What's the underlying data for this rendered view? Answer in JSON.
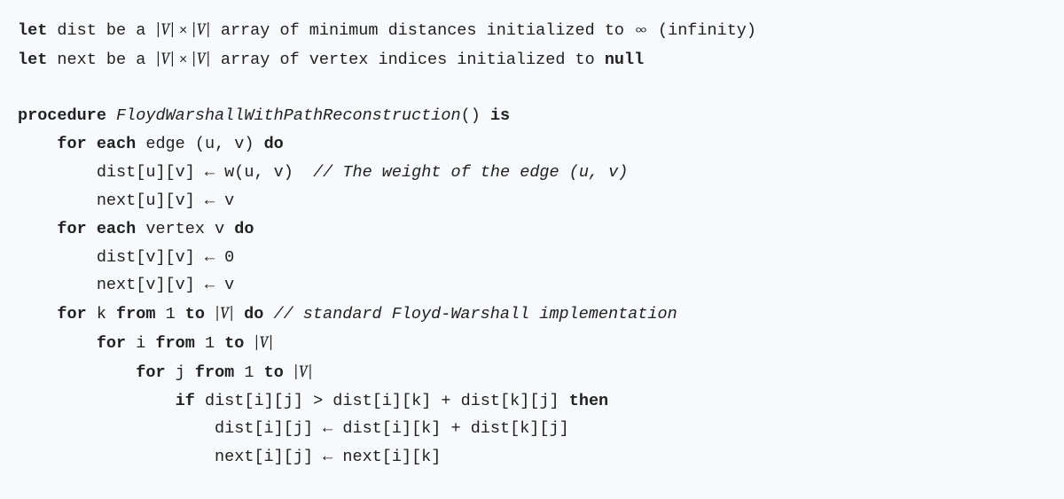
{
  "kw": {
    "let": "let",
    "procedure": "procedure",
    "is": "is",
    "for_each": "for each",
    "for": "for",
    "do": "do",
    "from": "from",
    "to": "to",
    "if": "if",
    "then": "then",
    "null": "null"
  },
  "txt": {
    "dist_decl_a": " dist be a ",
    "dist_decl_b": " array of minimum distances initialized to ",
    "infinity_glyph": "∞",
    "infinity_tail": " (infinity)",
    "next_decl_a": " next be a ",
    "next_decl_b": " array of vertex indices initialized to ",
    "proc_name": "FloydWarshallWithPathReconstruction",
    "parens": "()",
    "edge_uv": " edge (u, v) ",
    "l_dist_uv_assign": "dist[u][v] ← w(u, v)  ",
    "l_next_uv_assign": "next[u][v] ← v",
    "vertex_v": " vertex v ",
    "l_dist_vv_assign": "dist[v][v] ← 0",
    "l_next_vv_assign": "next[v][v] ← v",
    "sp_k": " k ",
    "sp_i": " i ",
    "sp_j": " j ",
    "one_to": " 1 ",
    "sp": " ",
    "if_cond": " dist[i][j] > dist[i][k] + dist[k][j] ",
    "l_dist_ij_assign": "dist[i][j] ← dist[i][k] + dist[k][j]",
    "l_next_ij_assign": "next[i][j] ← next[i][k]"
  },
  "comments": {
    "weight": "// The weight of the edge (u, v)",
    "standard": "// standard Floyd-Warshall implementation"
  },
  "math": {
    "V": "V",
    "times": "×",
    "bar": "|"
  },
  "indent": {
    "i1": "    ",
    "i2": "        ",
    "i3": "            ",
    "i4": "                ",
    "i5": "                    ",
    "i6": "                        "
  }
}
